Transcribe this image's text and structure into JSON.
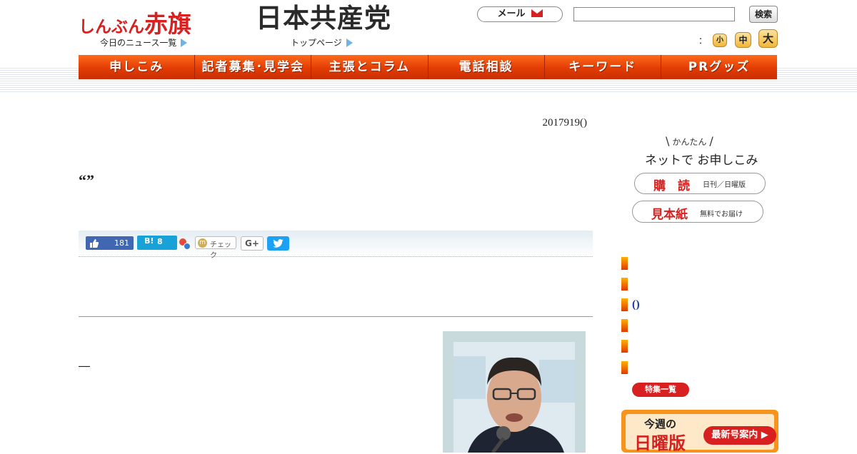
{
  "header": {
    "logo_akahata_kana": "しんぶん",
    "logo_akahata_kanji": "赤旗",
    "logo_party": "日本共産党",
    "link_today_news": "今日のニュース一覧",
    "link_top_page": "トップページ",
    "mail_label": "メール",
    "search_value": "",
    "search_button": "検索",
    "font_size_separator": "：",
    "font_small": "小",
    "font_medium": "中",
    "font_large": "大"
  },
  "nav": {
    "items": [
      {
        "label": "申しこみ"
      },
      {
        "label": "記者募集･見学会"
      },
      {
        "label": "主張とコラム"
      },
      {
        "label": "電話相談"
      },
      {
        "label": "キーワード"
      },
      {
        "label": "PRグッズ"
      }
    ]
  },
  "article": {
    "date": "2017919()",
    "title": "“”",
    "body_dash": "―"
  },
  "share": {
    "like_count": "181",
    "hatena_label": "B!",
    "hatena_count": "8",
    "check_label": "チェック",
    "gplus_label": "G+"
  },
  "sidebar": {
    "net_small": "かんたん",
    "net_main": "ネットで お申しこみ",
    "subscribe_label": "購　読",
    "subscribe_sub": "日刊／日曜版",
    "sample_label": "見本紙",
    "sample_sub": "無料でお届け",
    "list_paren": "()",
    "tokushu_label": "特集一覧",
    "sunday_line1": "今週の",
    "sunday_line2": "日曜版",
    "latest_label": "最新号案内 ▶"
  },
  "colors": {
    "brand_red": "#d7201f",
    "nav_orange": "#e84a0a",
    "facebook_blue": "#4267b2",
    "hatena_blue": "#19a2d8",
    "twitter_blue": "#1da1f2"
  },
  "icons": [
    "envelope-icon",
    "thumbs-up-icon",
    "hatena-bookmark-icon",
    "twitter-bird-icon",
    "play-triangle-icon"
  ]
}
